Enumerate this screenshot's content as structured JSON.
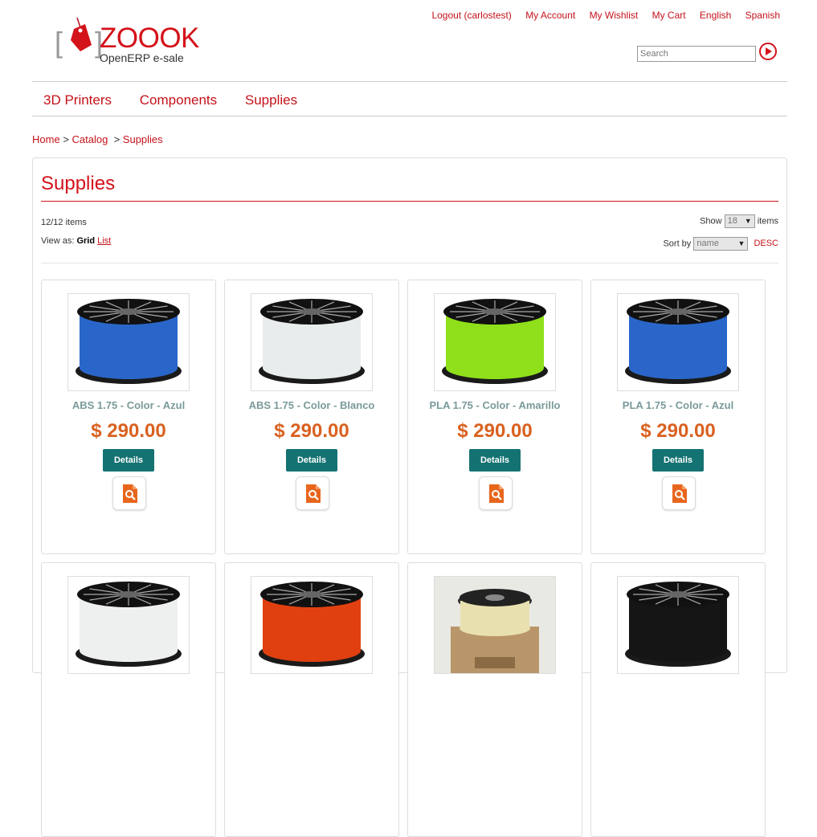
{
  "brand": {
    "name": "ZOOOK",
    "tagline": "OpenERP  e-sale"
  },
  "top_links": [
    {
      "label": "Logout (carlostest)"
    },
    {
      "label": "My Account"
    },
    {
      "label": "My Wishlist"
    },
    {
      "label": "My Cart"
    },
    {
      "label": "English"
    },
    {
      "label": "Spanish"
    }
  ],
  "search": {
    "placeholder": "Search"
  },
  "nav": [
    {
      "label": "3D Printers"
    },
    {
      "label": "Components"
    },
    {
      "label": "Supplies"
    }
  ],
  "breadcrumb": {
    "home": "Home",
    "catalog": "Catalog",
    "current": "Supplies",
    "sep": ">"
  },
  "page": {
    "title": "Supplies",
    "count": "12/12 items",
    "view_as_label": "View as:",
    "view_grid": "Grid",
    "view_list": "List",
    "show_label": "Show",
    "show_value": "18",
    "show_suffix": "items",
    "sort_label": "Sort by",
    "sort_value": "name",
    "sort_dir": "DESC"
  },
  "products": [
    {
      "name": "ABS 1.75 - Color - Azul",
      "price": "$ 290.00",
      "details": "Details",
      "color": "#2a66c9",
      "icon": "spool-image"
    },
    {
      "name": "ABS 1.75 - Color - Blanco",
      "price": "$ 290.00",
      "details": "Details",
      "color": "#e8ecec",
      "icon": "spool-image"
    },
    {
      "name": "PLA 1.75 - Color - Amarillo",
      "price": "$ 290.00",
      "details": "Details",
      "color": "#8fe01a",
      "icon": "spool-image"
    },
    {
      "name": "PLA 1.75 - Color - Azul",
      "price": "$ 290.00",
      "details": "Details",
      "color": "#2a66c9",
      "icon": "spool-image"
    },
    {
      "name": "",
      "price": "",
      "details": "",
      "color": "#eef0f0",
      "icon": "spool-image"
    },
    {
      "name": "",
      "price": "",
      "details": "",
      "color": "#e0400f",
      "icon": "spool-image"
    },
    {
      "name": "",
      "price": "",
      "details": "",
      "color": "#e9e0b0",
      "icon": "spool-box-image"
    },
    {
      "name": "",
      "price": "",
      "details": "",
      "color": "#151515",
      "icon": "spool-image"
    }
  ],
  "accent": "#c4121a",
  "price_color": "#d9611f",
  "button_color": "#157272"
}
